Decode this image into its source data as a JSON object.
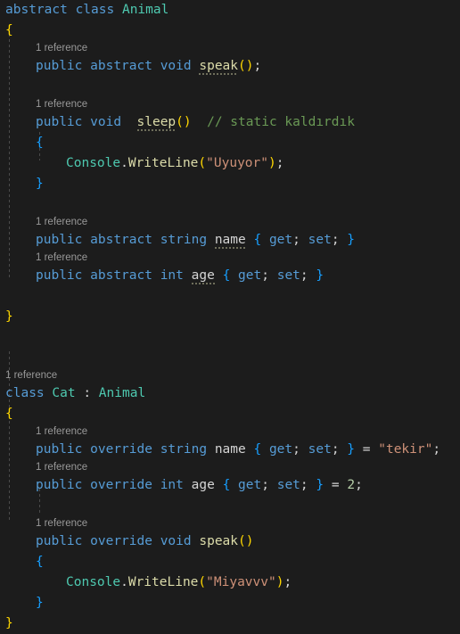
{
  "editor": {
    "language": "csharp",
    "theme": "dark-plus",
    "background_color": "#1c1c1c",
    "colors": {
      "keyword": "#569cd6",
      "type": "#4ec9b0",
      "method": "#dcdcaa",
      "string": "#ce9178",
      "number": "#b5cea8",
      "comment": "#6a9955",
      "plain": "#d4d4d4",
      "codelens": "#999999",
      "bracket_level_1": "#ffd700",
      "bracket_level_3": "#179fff"
    },
    "codelens_label": "1 reference",
    "tokens": {
      "kw_abstract": "abstract",
      "kw_class": "class",
      "kw_public": "public",
      "kw_void": "void",
      "kw_string": "string",
      "kw_int": "int",
      "kw_override": "override",
      "kw_get": "get",
      "kw_set": "set",
      "type_animal": "Animal",
      "type_cat": "Cat",
      "type_console": "Console",
      "mth_speak": "speak",
      "mth_sleep": "sleep",
      "mth_writeline": "WriteLine",
      "prop_name": "name",
      "prop_age": "age",
      "str_uyuyor": "\"Uyuyor\"",
      "str_miyavvv": "\"Miyavvv\"",
      "str_tekir": "\"tekir\"",
      "num_2": "2",
      "comment_static": "// static kaldırdık",
      "brace_open": "{",
      "brace_close": "}",
      "paren_open": "(",
      "paren_close": ")",
      "semi": ";",
      "colon": ":",
      "equals": "=",
      "dot": "."
    }
  }
}
